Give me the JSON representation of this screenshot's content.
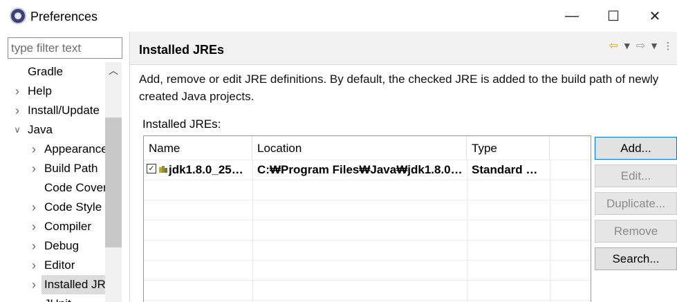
{
  "window": {
    "title": "Preferences",
    "minimize_glyph": "—",
    "maximize_glyph": "☐",
    "close_glyph": "✕"
  },
  "filter": {
    "placeholder": "type filter text",
    "value": ""
  },
  "tree": [
    {
      "label": "Gradle",
      "expand": "none"
    },
    {
      "label": "Help",
      "expand": "collapsed"
    },
    {
      "label": "Install/Update",
      "expand": "collapsed"
    },
    {
      "label": "Java",
      "expand": "expanded"
    },
    {
      "label": "Appearance",
      "expand": "collapsed"
    },
    {
      "label": "Build Path",
      "expand": "collapsed"
    },
    {
      "label": "Code Coverage",
      "expand": "none"
    },
    {
      "label": "Code Style",
      "expand": "collapsed"
    },
    {
      "label": "Compiler",
      "expand": "collapsed"
    },
    {
      "label": "Debug",
      "expand": "collapsed"
    },
    {
      "label": "Editor",
      "expand": "collapsed"
    },
    {
      "label": "Installed JREs",
      "expand": "collapsed",
      "selected": true
    },
    {
      "label": "JUnit",
      "expand": "none"
    }
  ],
  "page": {
    "title": "Installed JREs",
    "description": "Add, remove or edit JRE definitions. By default, the checked JRE is added to the build path of newly created Java projects.",
    "section_label": "Installed JREs:"
  },
  "table": {
    "columns": [
      "Name",
      "Location",
      "Type"
    ],
    "rows": [
      {
        "checked": true,
        "name": "jdk1.8.0_25…",
        "location": "C:₩Program Files₩Java₩jdk1.8.0…",
        "type": "Standard …"
      }
    ]
  },
  "buttons": {
    "add": "Add...",
    "edit": "Edit...",
    "duplicate": "Duplicate...",
    "remove": "Remove",
    "search": "Search..."
  },
  "icons": {
    "app": "eclipse-icon",
    "back": "back-arrow-icon",
    "forward": "forward-arrow-icon",
    "menu": "view-menu-icon"
  },
  "colors": {
    "accent": "#0078d7",
    "selection": "#dcdcdc",
    "header_band": "#f2f2f2"
  }
}
